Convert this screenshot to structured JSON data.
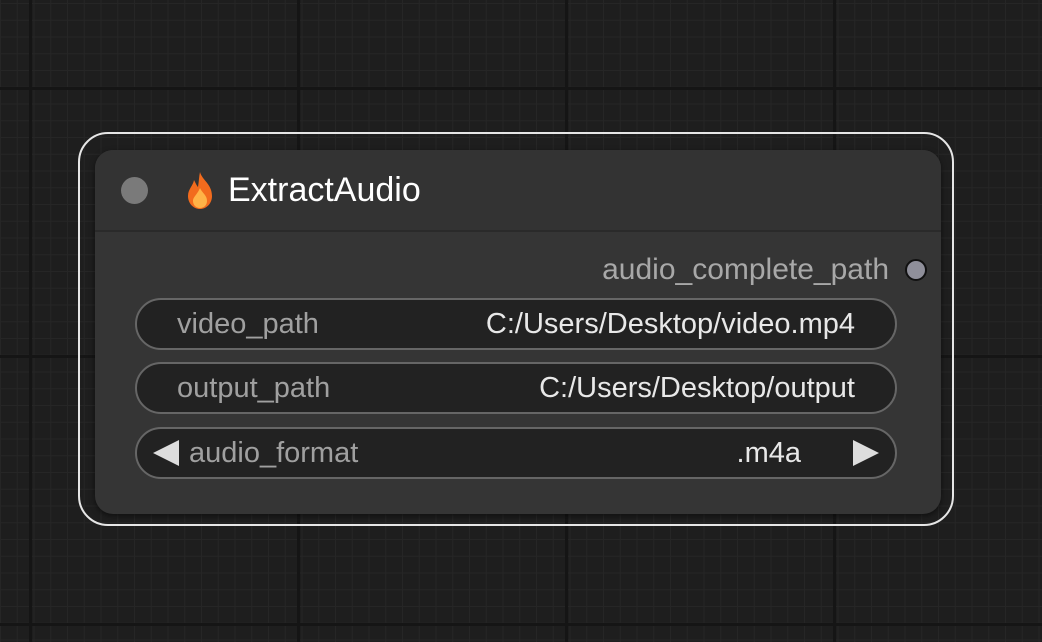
{
  "node": {
    "title": "ExtractAudio",
    "title_icon": "flame-icon",
    "collapse_icon": "circle-dot-icon",
    "output": {
      "label": "audio_complete_path",
      "slot_color": "#8f8f9a"
    },
    "widgets": {
      "video_path": {
        "label": "video_path",
        "value": "C:/Users/Desktop/video.mp4"
      },
      "output_path": {
        "label": "output_path",
        "value": "C:/Users/Desktop/output"
      },
      "audio_format": {
        "label": "audio_format",
        "value": ".m4a"
      }
    }
  },
  "colors": {
    "canvas_bg": "#1e1e1e",
    "node_bg": "#353535",
    "selection_outline": "#e6e6e6",
    "flame_outer": "#f26b1d",
    "flame_inner": "#ffb347"
  }
}
